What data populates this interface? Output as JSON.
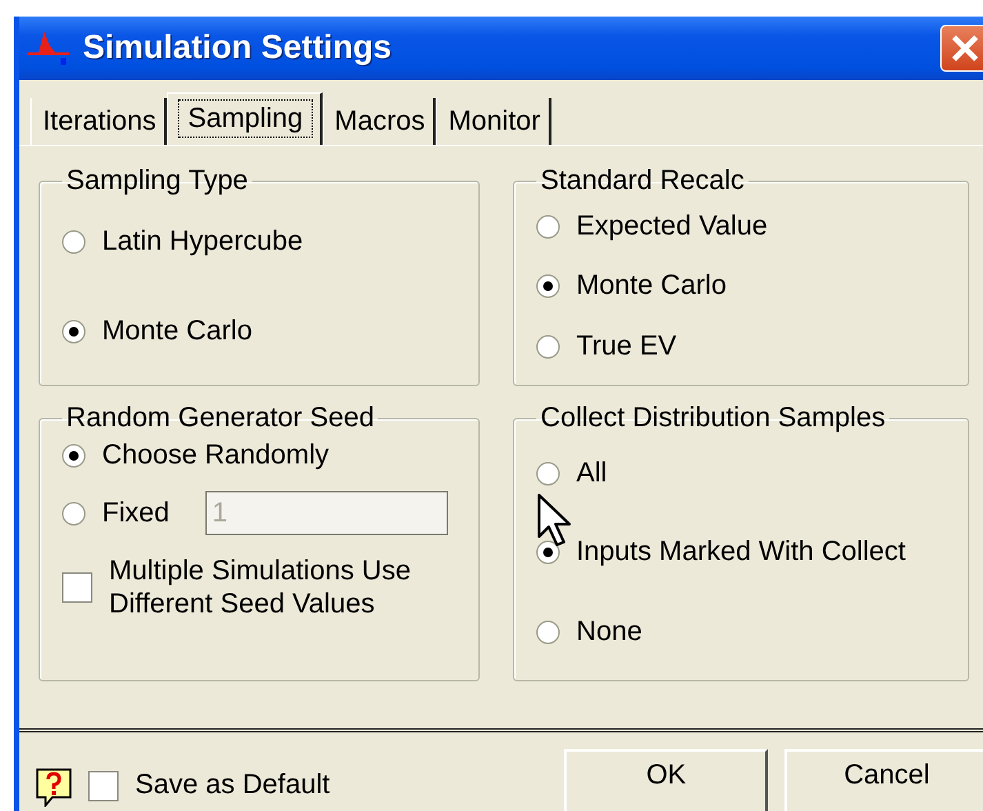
{
  "window": {
    "title": "Simulation Settings"
  },
  "tabs": [
    {
      "label": "Iterations",
      "selected": false
    },
    {
      "label": "Sampling",
      "selected": true
    },
    {
      "label": "Macros",
      "selected": false
    },
    {
      "label": "Monitor",
      "selected": false
    }
  ],
  "groups": [
    {
      "title": "Sampling Type",
      "items": [
        {
          "kind": "radio",
          "label": "Latin Hypercube",
          "selected": false
        },
        {
          "kind": "radio",
          "label": "Monte Carlo",
          "selected": true
        }
      ]
    },
    {
      "title": "Standard Recalc",
      "items": [
        {
          "kind": "radio",
          "label": "Expected Value",
          "selected": false
        },
        {
          "kind": "radio",
          "label": "Monte Carlo",
          "selected": true
        },
        {
          "kind": "radio",
          "label": "True EV",
          "selected": false
        }
      ]
    },
    {
      "title": "Random Generator Seed",
      "items": [
        {
          "kind": "radio",
          "label": "Choose Randomly",
          "selected": true
        },
        {
          "kind": "radio",
          "label": "Fixed",
          "selected": false,
          "field": {
            "value": "1",
            "disabled": true
          }
        },
        {
          "kind": "checkbox",
          "label": "Multiple Simulations Use Different Seed Values",
          "checked": false
        }
      ]
    },
    {
      "title": "Collect Distribution Samples",
      "items": [
        {
          "kind": "radio",
          "label": "All",
          "selected": false
        },
        {
          "kind": "radio",
          "label": "Inputs Marked With Collect",
          "selected": true
        },
        {
          "kind": "radio",
          "label": "None",
          "selected": false
        }
      ]
    }
  ],
  "footer": {
    "save_default": {
      "label": "Save as Default",
      "checked": false
    },
    "buttons": [
      "OK",
      "Cancel"
    ]
  }
}
